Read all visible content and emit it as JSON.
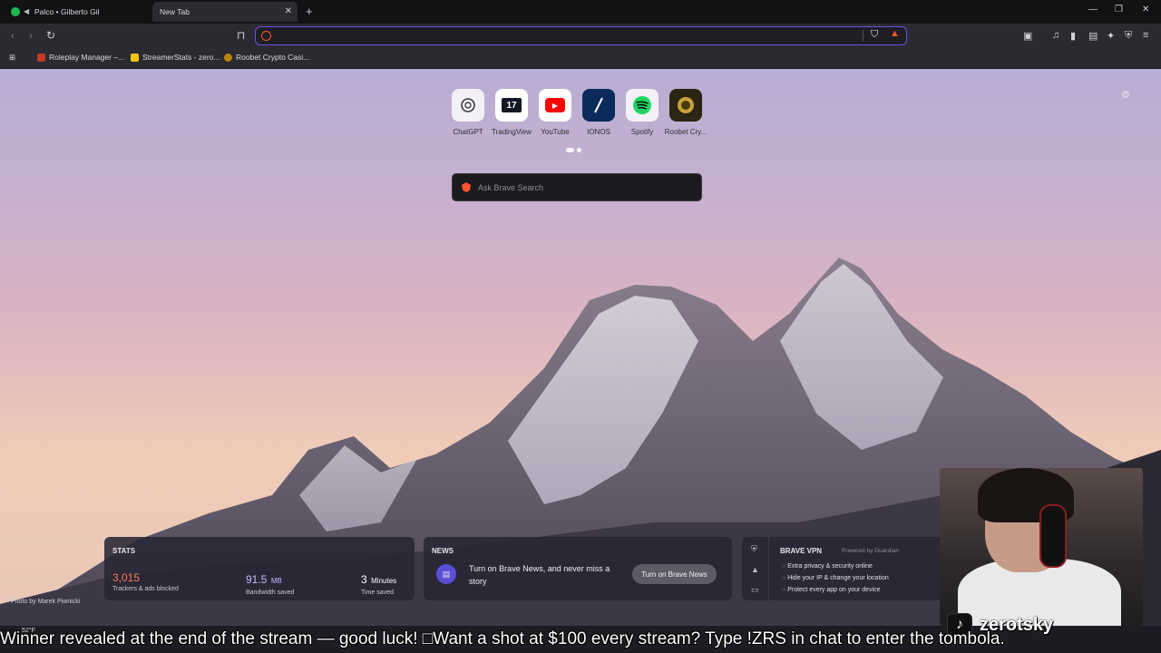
{
  "tabs": [
    {
      "title": "Palco • Gilberto Gil",
      "active": false
    },
    {
      "title": "New Tab",
      "active": true
    }
  ],
  "bookmarks": [
    {
      "label": "Roleplay Manager –...",
      "color": "#c0392b"
    },
    {
      "label": "StreamerStats - zero...",
      "color": "#f1c40f"
    },
    {
      "label": "Roobet Crypto Casi...",
      "color": "#b8860b"
    }
  ],
  "top_sites": [
    {
      "label": "ChatGPT",
      "icon": "chatgpt-icon"
    },
    {
      "label": "TradingView",
      "icon": "tradingview-icon"
    },
    {
      "label": "YouTube",
      "icon": "youtube-icon"
    },
    {
      "label": "IONOS",
      "icon": "ionos-icon"
    },
    {
      "label": "Spotify",
      "icon": "spotify-icon"
    },
    {
      "label": "Roobet Cry...",
      "icon": "roobet-icon"
    }
  ],
  "search": {
    "placeholder": "Ask Brave Search"
  },
  "photo_credit": "Photo by Marek Piwnicki",
  "stats": {
    "title": "STATS",
    "blocked": {
      "value": "3,015",
      "caption": "Trackers & ads blocked"
    },
    "bandwidth": {
      "value": "91.5",
      "unit": "MB",
      "caption": "Bandwidth saved"
    },
    "time": {
      "value": "3",
      "unit": "Minutes",
      "caption": "Time saved"
    }
  },
  "news": {
    "title": "NEWS",
    "text": "Turn on Brave News, and never miss a story",
    "button": "Turn on Brave News"
  },
  "vpn": {
    "title": "BRAVE VPN",
    "powered": "Powered by Guardian",
    "items": [
      "Extra privacy & security online",
      "Hide your IP & change your location",
      "Protect every app on your device"
    ]
  },
  "overlay": {
    "channel": "zerotsky",
    "ticker": "Winner revealed at the end of the stream — good luck! □Want a shot at $100 every stream? Type !ZRS in chat to enter the tombola."
  },
  "weather": "52°F",
  "colors": {
    "accent": "#6e4fe0",
    "brave": "#fb542b"
  }
}
